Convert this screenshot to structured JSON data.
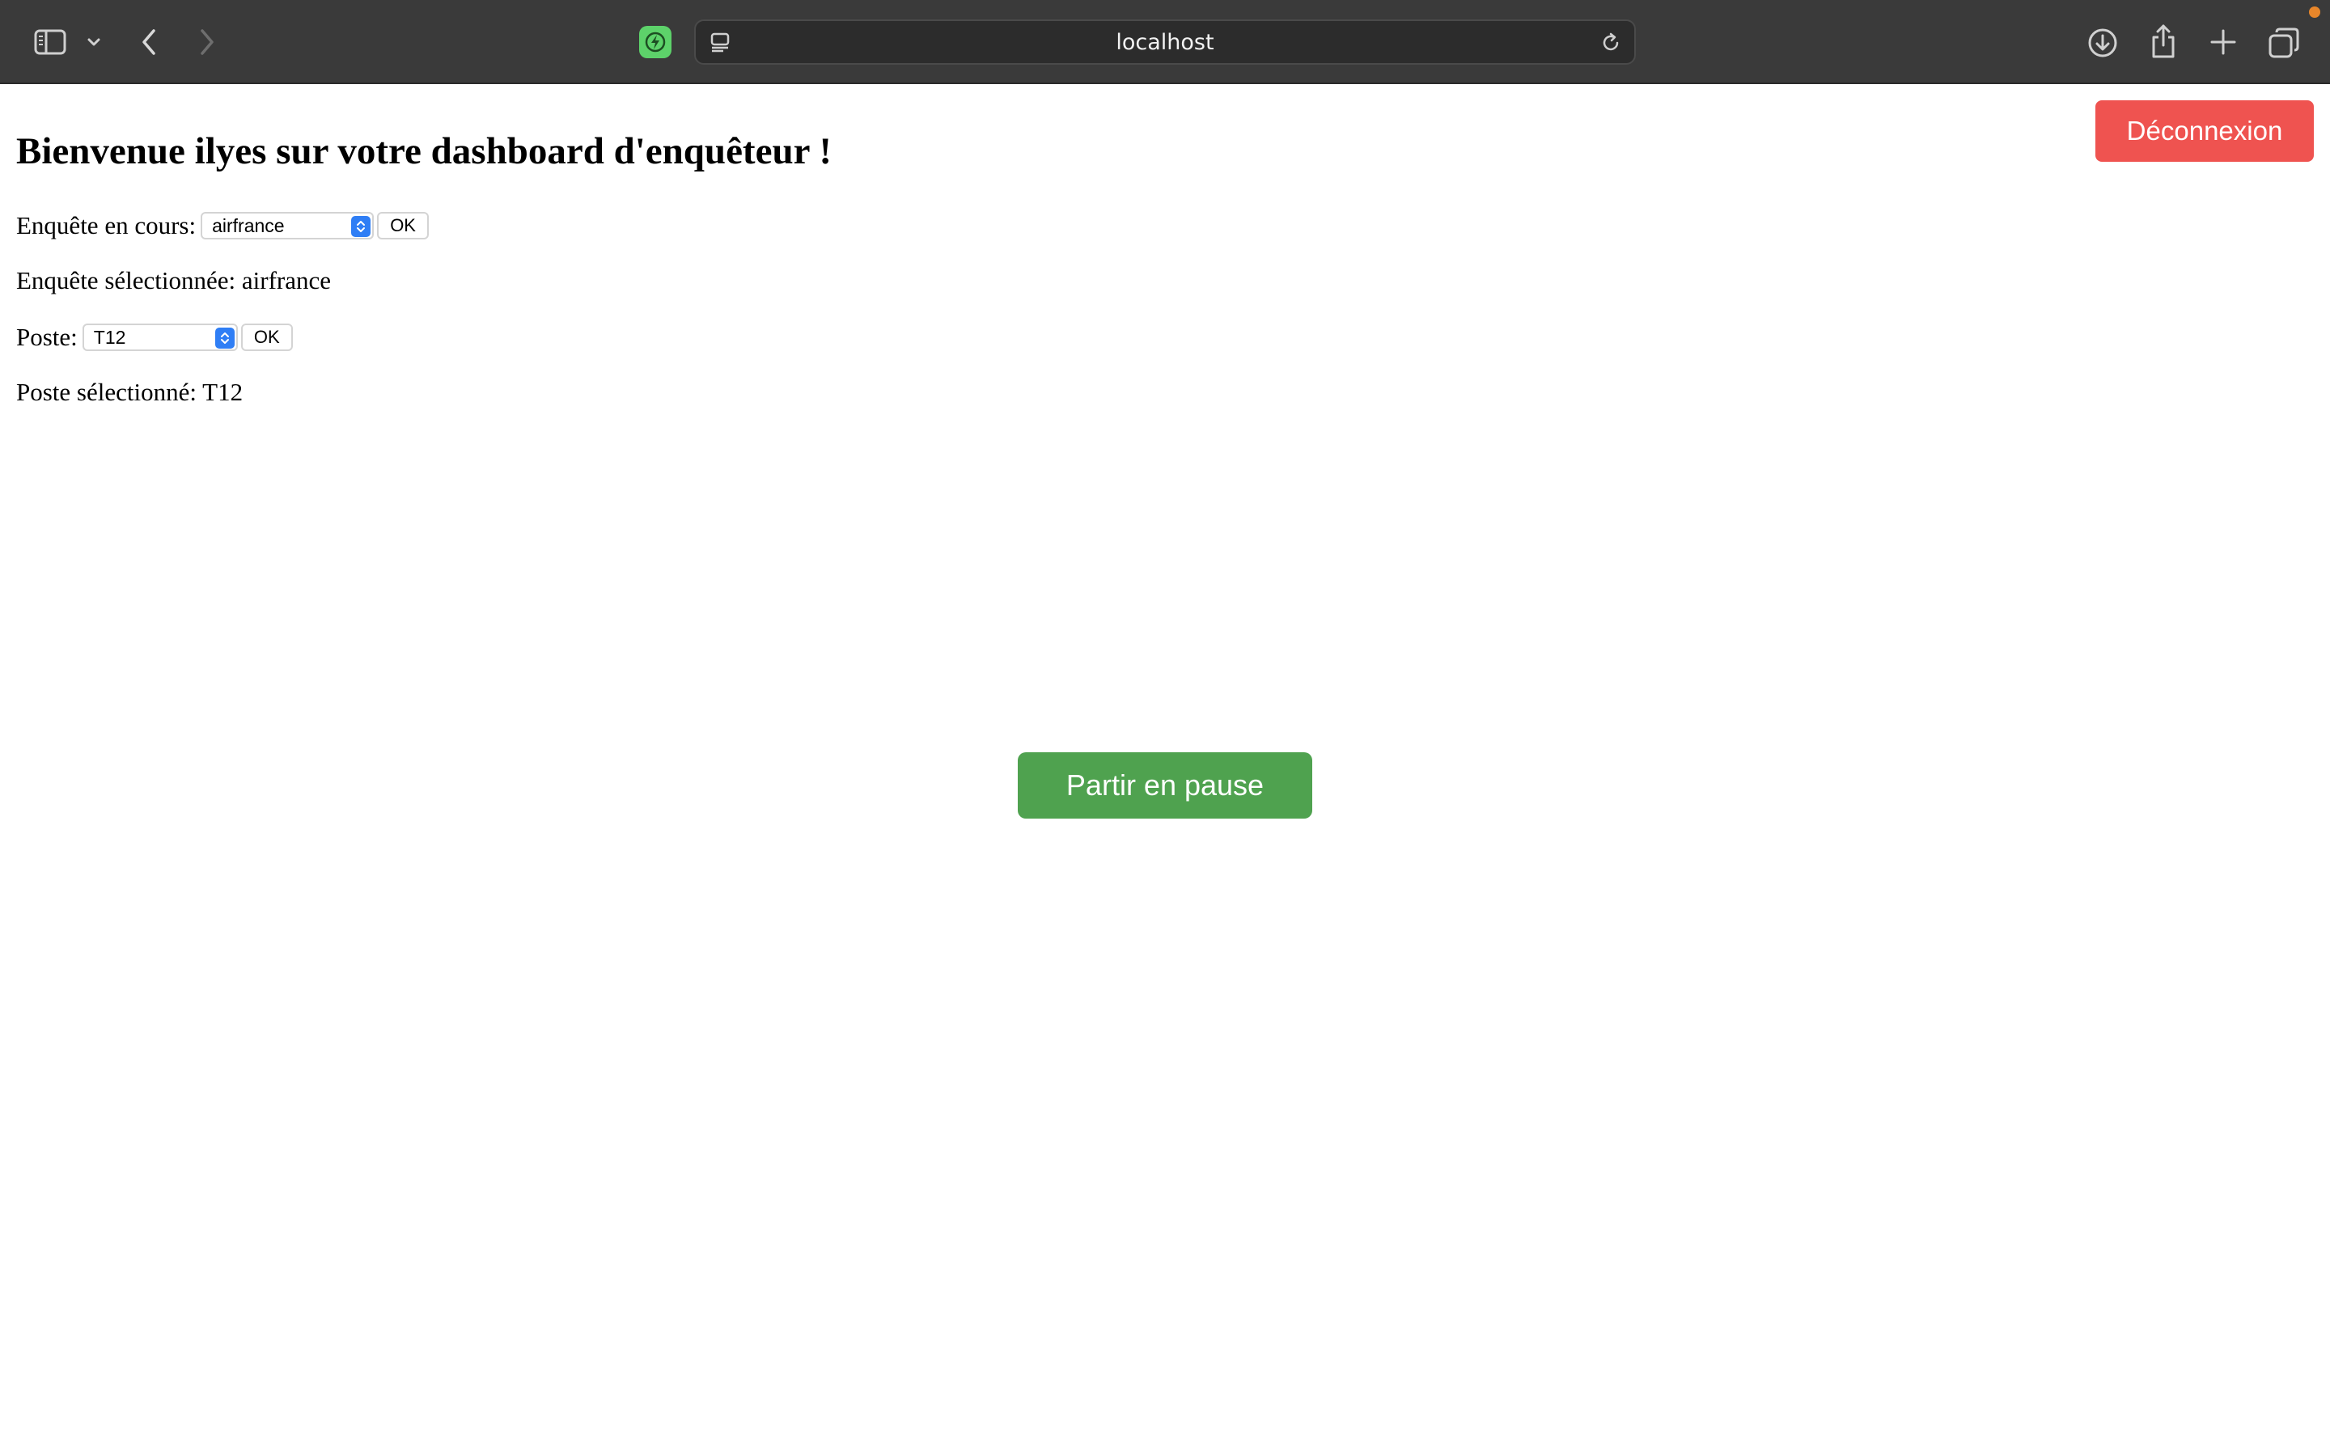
{
  "browser": {
    "url": "localhost",
    "icons": {
      "sidebar": "sidebar-icon",
      "chevron": "chevron-down-icon",
      "back": "chevron-left-icon",
      "forward": "chevron-right-icon",
      "extension": "bolt-icon",
      "reader": "reader-icon",
      "reload": "reload-icon",
      "download": "download-icon",
      "share": "share-icon",
      "new_tab": "plus-icon",
      "tabs": "tabs-overview-icon"
    },
    "colors": {
      "toolbar_bg": "#3a3a3a",
      "extension_bg": "#5dd26a",
      "notification_dot": "#e8862a"
    }
  },
  "page": {
    "logout_label": "Déconnexion",
    "title": "Bienvenue ilyes sur votre dashboard d'enquêteur !",
    "survey": {
      "label": "Enquête en cours:",
      "selected_value": "airfrance",
      "ok_label": "OK",
      "selected_text": "Enquête sélectionnée: airfrance"
    },
    "post": {
      "label": "Poste:",
      "selected_value": "T12",
      "ok_label": "OK",
      "selected_text": "Poste sélectionné: T12"
    },
    "pause_label": "Partir en pause",
    "colors": {
      "logout": "#ef5350",
      "pause": "#4fa24f",
      "select_stepper": "#2f7ef5"
    }
  }
}
